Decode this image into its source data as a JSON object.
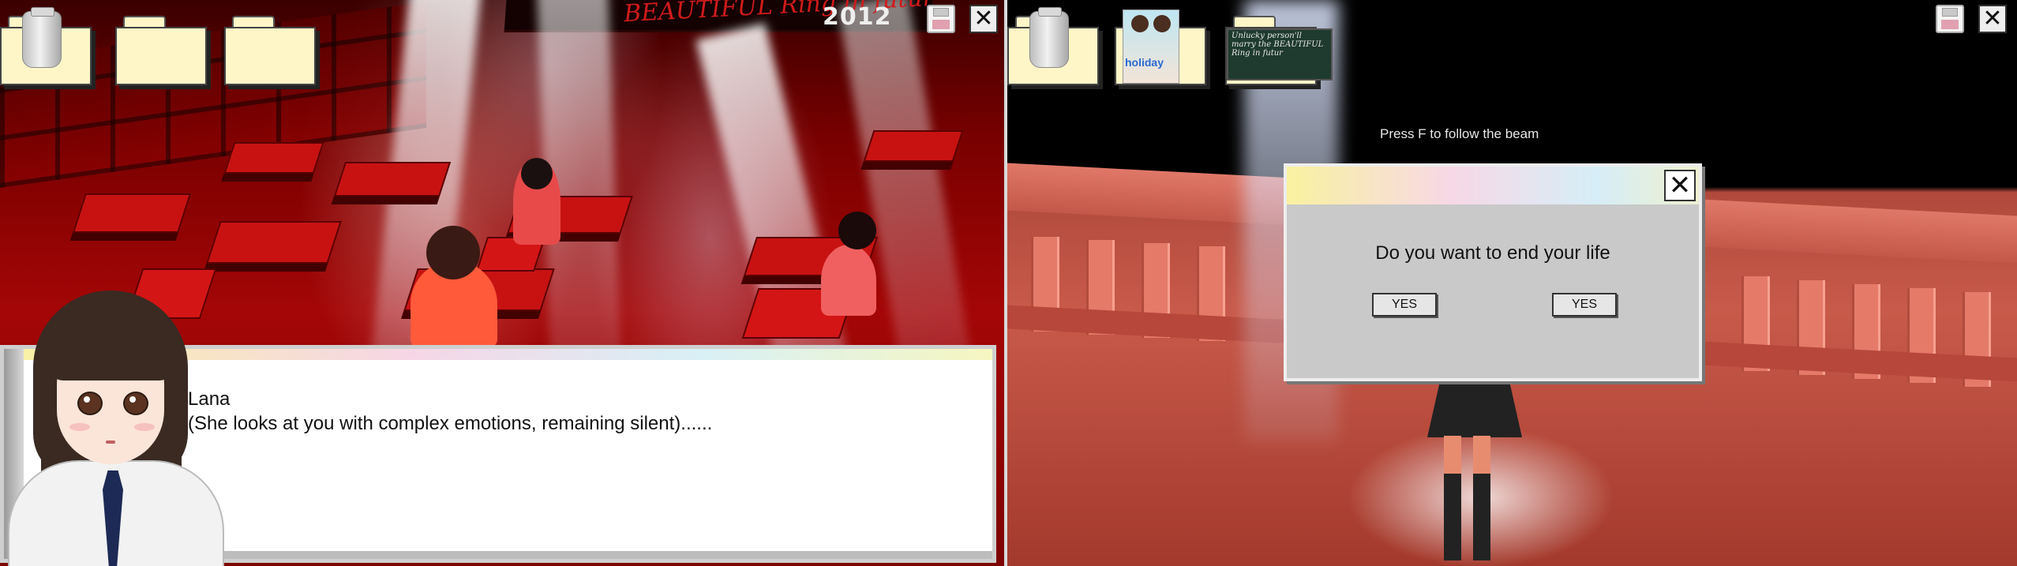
{
  "left": {
    "chalkboard": {
      "text": "BEAUTIFUL\nRing in futur",
      "year": "2012"
    },
    "dialog": {
      "speaker": "Lana",
      "line": "(She looks at you with complex emotions, remaining silent)......"
    }
  },
  "right": {
    "hint": "Press F to follow the beam",
    "modal": {
      "question": "Do you want to end your life",
      "yes_left": "YES",
      "yes_right": "YES",
      "close_glyph": "✕"
    },
    "thumbnails": {
      "holiday_label": "holiday",
      "chalk_note": "Unlucky person'll marry the BEAUTIFUL Ring in futur"
    }
  },
  "system": {
    "close_glyph": "✕"
  },
  "colors": {
    "scene_red": "#a40606",
    "folder": "#fff6c8",
    "modal_gray": "#c9c9c9",
    "dialog_white": "#ffffff"
  },
  "icons": [
    "jar-icon",
    "folder-icon",
    "floppy-disk-icon",
    "close-icon"
  ]
}
